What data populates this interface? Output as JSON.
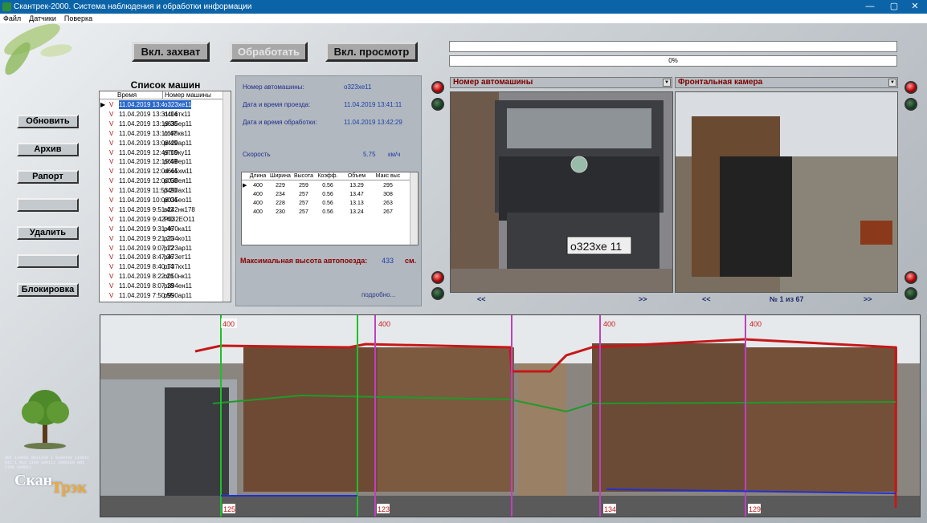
{
  "window": {
    "title": "Скантрек-2000. Система наблюдения и обработки информации",
    "minimize": "—",
    "maximize": "▢",
    "close": "✕"
  },
  "menu": [
    "Файл",
    "Датчики",
    "Поверка"
  ],
  "left_buttons": [
    "Обновить",
    "Архив",
    "Рапорт",
    "",
    "Удалить",
    "",
    "Блокировка"
  ],
  "top_buttons": {
    "capture": "Вкл. захват",
    "process": "Обработать",
    "view": "Вкл. просмотр"
  },
  "progress": {
    "value": 0,
    "label": "0%"
  },
  "car_list": {
    "title": "Список машин",
    "columns": [
      "Время",
      "Номер машины"
    ],
    "rows": [
      {
        "flag": "V",
        "time": "11.04.2019 13:42:29",
        "plate": "о323хе11",
        "selected": true
      },
      {
        "flag": "V",
        "time": "11.04.2019 13:31:14",
        "plate": "о406тк11"
      },
      {
        "flag": "V",
        "time": "11.04.2019 13:19:30",
        "plate": "р635ер11"
      },
      {
        "flag": "V",
        "time": "11.04.2019 13:11:47",
        "plate": "с698кв11"
      },
      {
        "flag": "V",
        "time": "11.04.2019 13:08:49",
        "plate": "р420ар11"
      },
      {
        "flag": "V",
        "time": "11.04.2019 12:49:10",
        "plate": "р709ку11"
      },
      {
        "flag": "V",
        "time": "11.04.2019 12:15:49",
        "plate": "р658ер11"
      },
      {
        "flag": "V",
        "time": "11.04.2019 12:04:44",
        "plate": "о665хм11"
      },
      {
        "flag": "V",
        "time": "11.04.2019 12:00:50",
        "plate": "р038ея11"
      },
      {
        "flag": "V",
        "time": "11.04.2019 11:53:20",
        "plate": "р490ах11"
      },
      {
        "flag": "V",
        "time": "11.04.2019 10:08:04",
        "plate": "р035ео11"
      },
      {
        "flag": "V",
        "time": "11.04.2019 9:51:42",
        "plate": "в242нк178"
      },
      {
        "flag": "V",
        "time": "11.04.2019 9:42:40",
        "plate": "Р032ЕО11"
      },
      {
        "flag": "V",
        "time": "11.04.2019 9:31:46",
        "plate": "р470ка11"
      },
      {
        "flag": "V",
        "time": "11.04.2019 9:21:25",
        "plate": "р134ко11"
      },
      {
        "flag": "V",
        "time": "11.04.2019 9:07:12",
        "plate": "р723ар11"
      },
      {
        "flag": "V",
        "time": "11.04.2019 8:47:36",
        "plate": "р473ет11"
      },
      {
        "flag": "V",
        "time": "11.04.2019 8:40:14",
        "plate": "р737кх11"
      },
      {
        "flag": "V",
        "time": "11.04.2019 8:22:21",
        "plate": "о050нк11"
      },
      {
        "flag": "V",
        "time": "11.04.2019 8:07:18",
        "plate": "р394ен11"
      },
      {
        "flag": "V",
        "time": "11.04.2019 7:50:55",
        "plate": "р990ар11"
      }
    ]
  },
  "info": {
    "plate_label": "Номер автомашины:",
    "plate_value": "о323хе11",
    "pass_label": "Дата и время проезда:",
    "pass_value": "11.04.2019 13:41:11",
    "proc_label": "Дата и время обработки:",
    "proc_value": "11.04.2019 13:42:29",
    "speed_label": "Скорость",
    "speed_value": "5.75",
    "speed_unit": "км/ч",
    "max_height_label": "Максимальная высота автопоезда:",
    "max_height_value": "433",
    "max_height_unit": "см.",
    "details_link": "подробно..."
  },
  "dims_table": {
    "columns": [
      "Длина",
      "Ширина",
      "Высота",
      "Коэфф.",
      "Объем",
      "Макс выс"
    ],
    "rows": [
      [
        "400",
        "229",
        "259",
        "0.56",
        "13.29",
        "295"
      ],
      [
        "400",
        "234",
        "257",
        "0.56",
        "13.47",
        "308"
      ],
      [
        "400",
        "228",
        "257",
        "0.56",
        "13.13",
        "263"
      ],
      [
        "400",
        "230",
        "257",
        "0.56",
        "13.24",
        "267"
      ]
    ]
  },
  "cameras": {
    "left": {
      "title": "Номер автомашины",
      "plate_text": "о323хе 11",
      "prev": "<<",
      "next": ">>"
    },
    "right": {
      "title": "Фронтальная камера",
      "prev": "<<",
      "next": ">>",
      "counter": "№ 1 из 67"
    }
  },
  "panorama": {
    "top_labels": [
      "400",
      "400",
      "400",
      "400"
    ],
    "bottom_labels": [
      "125",
      "123",
      "134",
      "129"
    ]
  },
  "logo": {
    "text_a": "Скан",
    "text_b": "Трэк",
    "binary": "001 110001 0011100 1 0100100 110011 011 1 011 1100 100111 1000100 001 1100 100011"
  },
  "colors": {
    "title_bar": "#0c64a8",
    "camera_title": "#7a0000",
    "info_text": "#1f2e8a",
    "selection": "#2a68c8"
  }
}
